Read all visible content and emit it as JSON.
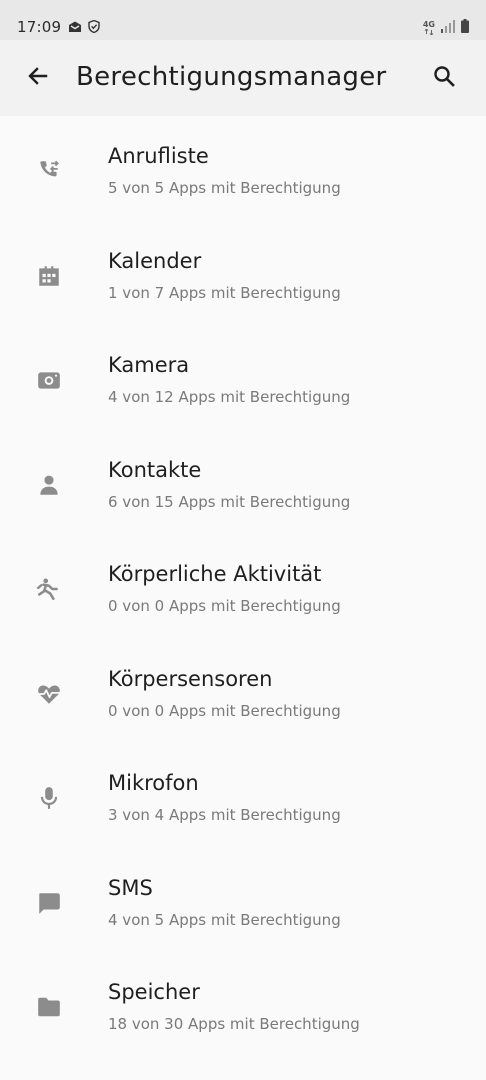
{
  "status_bar": {
    "time": "17:09",
    "network": "4G"
  },
  "app_bar": {
    "title": "Berechtigungsmanager",
    "back_icon": "arrow-left-icon",
    "search_icon": "search-icon"
  },
  "permissions": [
    {
      "label": "Anrufliste",
      "summary": "5 von 5 Apps mit Berechtigung",
      "icon": "call-log-icon"
    },
    {
      "label": "Kalender",
      "summary": "1 von 7 Apps mit Berechtigung",
      "icon": "calendar-icon"
    },
    {
      "label": "Kamera",
      "summary": "4 von 12 Apps mit Berechtigung",
      "icon": "camera-icon"
    },
    {
      "label": "Kontakte",
      "summary": "6 von 15 Apps mit Berechtigung",
      "icon": "person-icon"
    },
    {
      "label": "Körperliche Aktivität",
      "summary": "0 von 0 Apps mit Berechtigung",
      "icon": "activity-icon"
    },
    {
      "label": "Körpersensoren",
      "summary": "0 von 0 Apps mit Berechtigung",
      "icon": "heart-pulse-icon"
    },
    {
      "label": "Mikrofon",
      "summary": "3 von 4 Apps mit Berechtigung",
      "icon": "microphone-icon"
    },
    {
      "label": "SMS",
      "summary": "4 von 5 Apps mit Berechtigung",
      "icon": "message-icon"
    },
    {
      "label": "Speicher",
      "summary": "18 von 30 Apps mit Berechtigung",
      "icon": "folder-icon"
    }
  ],
  "colors": {
    "background": "#fafafa",
    "app_bar": "#f2f2f2",
    "status_bar": "#e8e8e8",
    "icon_gray": "#8c8c8c",
    "subtitle_gray": "#7a7a7a"
  }
}
